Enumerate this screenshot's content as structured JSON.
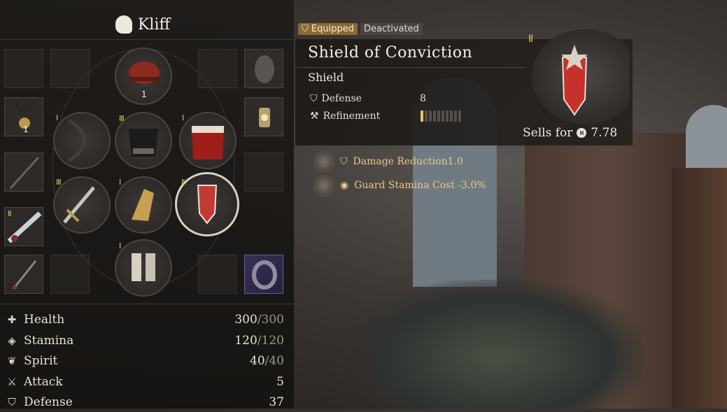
{
  "character": {
    "name": "Kliff"
  },
  "equipment": {
    "helmet_count": "1",
    "necklace_count": "1",
    "tiers": {
      "bow": "I",
      "armor": "III",
      "cloak": "I",
      "sword": "III",
      "gauntlet": "I",
      "shield": "II",
      "boots": "I",
      "greatsword": "II"
    }
  },
  "stats": [
    {
      "label": "Health",
      "value": "300",
      "max": "/300",
      "icon": "health-icon"
    },
    {
      "label": "Stamina",
      "value": "120",
      "max": "/120",
      "icon": "stamina-icon"
    },
    {
      "label": "Spirit",
      "value": "40",
      "max": "/40",
      "icon": "spirit-icon"
    },
    {
      "label": "Attack",
      "value": "5",
      "max": "",
      "icon": "attack-icon"
    },
    {
      "label": "Defense",
      "value": "37",
      "max": "",
      "icon": "defense-icon"
    }
  ],
  "item": {
    "badges": {
      "equipped": "Equipped",
      "deactivated": "Deactivated"
    },
    "name": "Shield of Conviction",
    "type": "Shield",
    "tier": "II",
    "defense_label": "Defense",
    "defense_value": "8",
    "refinement_label": "Refinement",
    "refinement_level": 1,
    "refinement_max": 10,
    "sells_label": "Sells for",
    "sells_value": "7.78"
  },
  "perks": [
    {
      "text": "Damage Reduction1.0"
    },
    {
      "text": "Guard Stamina Cost -3.0%"
    }
  ],
  "colors": {
    "accent_gold": "#e6c75a",
    "perk_text": "#e8c98a",
    "equipped_badge": "#8a6a35"
  }
}
